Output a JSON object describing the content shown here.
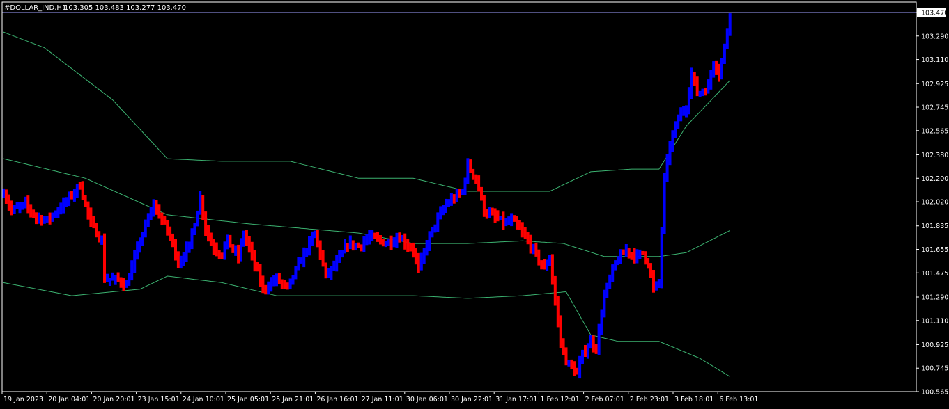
{
  "header": {
    "symbol_label": "#DOLLAR_IND,H1",
    "ohlc_text": "103.305 103.483 103.277 103.470"
  },
  "colors": {
    "background": "#000000",
    "frame": "#ffffff",
    "bull_bar": "#0000ff",
    "bear_bar": "#ff0000",
    "band_line": "#3cb371",
    "price_line": "#a0a0ff",
    "text": "#ffffff"
  },
  "chart_data": {
    "type": "ohlc-bars",
    "title": "#DOLLAR_IND,H1",
    "timeframe": "H1",
    "current_price": 103.47,
    "ylim": [
      100.565,
      103.55
    ],
    "y_ticks": [
      "103.470",
      "103.290",
      "103.110",
      "102.925",
      "102.745",
      "102.565",
      "102.380",
      "102.200",
      "102.020",
      "101.835",
      "101.655",
      "101.475",
      "101.290",
      "101.110",
      "100.925",
      "100.745",
      "100.565"
    ],
    "x_ticks": [
      "19 Jan 2023",
      "20 Jan 04:01",
      "20 Jan 20:01",
      "23 Jan 15:01",
      "24 Jan 10:01",
      "25 Jan 05:01",
      "25 Jan 21:01",
      "26 Jan 16:01",
      "27 Jan 11:01",
      "30 Jan 06:01",
      "30 Jan 22:01",
      "31 Jan 17:01",
      "1 Feb 12:01",
      "2 Feb 07:01",
      "2 Feb 23:01",
      "3 Feb 18:01",
      "6 Feb 13:01"
    ],
    "indicator": "Bollinger Bands (upper, middle, lower)",
    "close_anchors": [
      [
        0,
        102.1
      ],
      [
        3,
        101.95
      ],
      [
        8,
        102.0
      ],
      [
        12,
        101.9
      ],
      [
        16,
        101.88
      ],
      [
        22,
        102.0
      ],
      [
        28,
        102.15
      ],
      [
        32,
        101.85
      ],
      [
        36,
        101.72
      ],
      [
        37,
        101.43
      ],
      [
        42,
        101.42
      ],
      [
        45,
        101.38
      ],
      [
        50,
        101.72
      ],
      [
        55,
        102.0
      ],
      [
        60,
        101.8
      ],
      [
        62,
        101.7
      ],
      [
        64,
        101.55
      ],
      [
        68,
        101.68
      ],
      [
        72,
        102.05
      ],
      [
        74,
        101.82
      ],
      [
        76,
        101.7
      ],
      [
        78,
        101.65
      ],
      [
        80,
        101.62
      ],
      [
        82,
        101.73
      ],
      [
        84,
        101.65
      ],
      [
        86,
        101.6
      ],
      [
        88,
        101.78
      ],
      [
        91,
        101.6
      ],
      [
        95,
        101.35
      ],
      [
        100,
        101.43
      ],
      [
        104,
        101.35
      ],
      [
        106,
        101.45
      ],
      [
        110,
        101.62
      ],
      [
        114,
        101.78
      ],
      [
        116,
        101.62
      ],
      [
        118,
        101.45
      ],
      [
        122,
        101.55
      ],
      [
        126,
        101.7
      ],
      [
        130,
        101.68
      ],
      [
        134,
        101.75
      ],
      [
        138,
        101.72
      ],
      [
        140,
        101.7
      ],
      [
        145,
        101.75
      ],
      [
        150,
        101.65
      ],
      [
        152,
        101.5
      ],
      [
        155,
        101.7
      ],
      [
        158,
        101.85
      ],
      [
        162,
        102.0
      ],
      [
        165,
        102.05
      ],
      [
        168,
        102.1
      ],
      [
        170,
        102.3
      ],
      [
        173,
        102.2
      ],
      [
        176,
        101.95
      ],
      [
        180,
        101.9
      ],
      [
        184,
        101.85
      ],
      [
        186,
        101.88
      ],
      [
        190,
        101.78
      ],
      [
        194,
        101.65
      ],
      [
        198,
        101.5
      ],
      [
        200,
        101.6
      ],
      [
        202,
        101.25
      ],
      [
        204,
        100.95
      ],
      [
        206,
        100.8
      ],
      [
        208,
        100.75
      ],
      [
        210,
        100.7
      ],
      [
        212,
        100.85
      ],
      [
        215,
        100.95
      ],
      [
        217,
        100.9
      ],
      [
        220,
        101.3
      ],
      [
        224,
        101.55
      ],
      [
        228,
        101.65
      ],
      [
        230,
        101.62
      ],
      [
        232,
        101.6
      ],
      [
        234,
        101.63
      ],
      [
        236,
        101.55
      ],
      [
        238,
        101.35
      ],
      [
        240,
        101.4
      ],
      [
        242,
        102.2
      ],
      [
        244,
        102.45
      ],
      [
        246,
        102.6
      ],
      [
        248,
        102.7
      ],
      [
        250,
        102.75
      ],
      [
        252,
        103.0
      ],
      [
        254,
        102.85
      ],
      [
        256,
        102.87
      ],
      [
        258,
        102.9
      ],
      [
        260,
        103.1
      ],
      [
        262,
        103.0
      ],
      [
        264,
        103.2
      ],
      [
        266,
        103.47
      ]
    ],
    "bands": {
      "upper": [
        [
          0,
          103.32
        ],
        [
          15,
          103.2
        ],
        [
          40,
          102.8
        ],
        [
          60,
          102.35
        ],
        [
          80,
          102.33
        ],
        [
          105,
          102.33
        ],
        [
          130,
          102.2
        ],
        [
          150,
          102.2
        ],
        [
          170,
          102.1
        ],
        [
          186,
          102.1
        ],
        [
          200,
          102.1
        ],
        [
          215,
          102.25
        ],
        [
          230,
          102.27
        ],
        [
          240,
          102.27
        ],
        [
          250,
          102.6
        ],
        [
          266,
          102.95
        ]
      ],
      "middle": [
        [
          0,
          102.35
        ],
        [
          30,
          102.2
        ],
        [
          60,
          101.92
        ],
        [
          90,
          101.85
        ],
        [
          130,
          101.78
        ],
        [
          150,
          101.7
        ],
        [
          170,
          101.7
        ],
        [
          190,
          101.72
        ],
        [
          205,
          101.7
        ],
        [
          220,
          101.6
        ],
        [
          240,
          101.6
        ],
        [
          250,
          101.63
        ],
        [
          266,
          101.8
        ]
      ],
      "lower": [
        [
          0,
          101.4
        ],
        [
          25,
          101.3
        ],
        [
          50,
          101.35
        ],
        [
          60,
          101.45
        ],
        [
          80,
          101.4
        ],
        [
          100,
          101.3
        ],
        [
          130,
          101.3
        ],
        [
          150,
          101.3
        ],
        [
          170,
          101.28
        ],
        [
          190,
          101.3
        ],
        [
          206,
          101.33
        ],
        [
          215,
          101.0
        ],
        [
          225,
          100.95
        ],
        [
          240,
          100.95
        ],
        [
          255,
          100.82
        ],
        [
          266,
          100.68
        ]
      ]
    }
  }
}
